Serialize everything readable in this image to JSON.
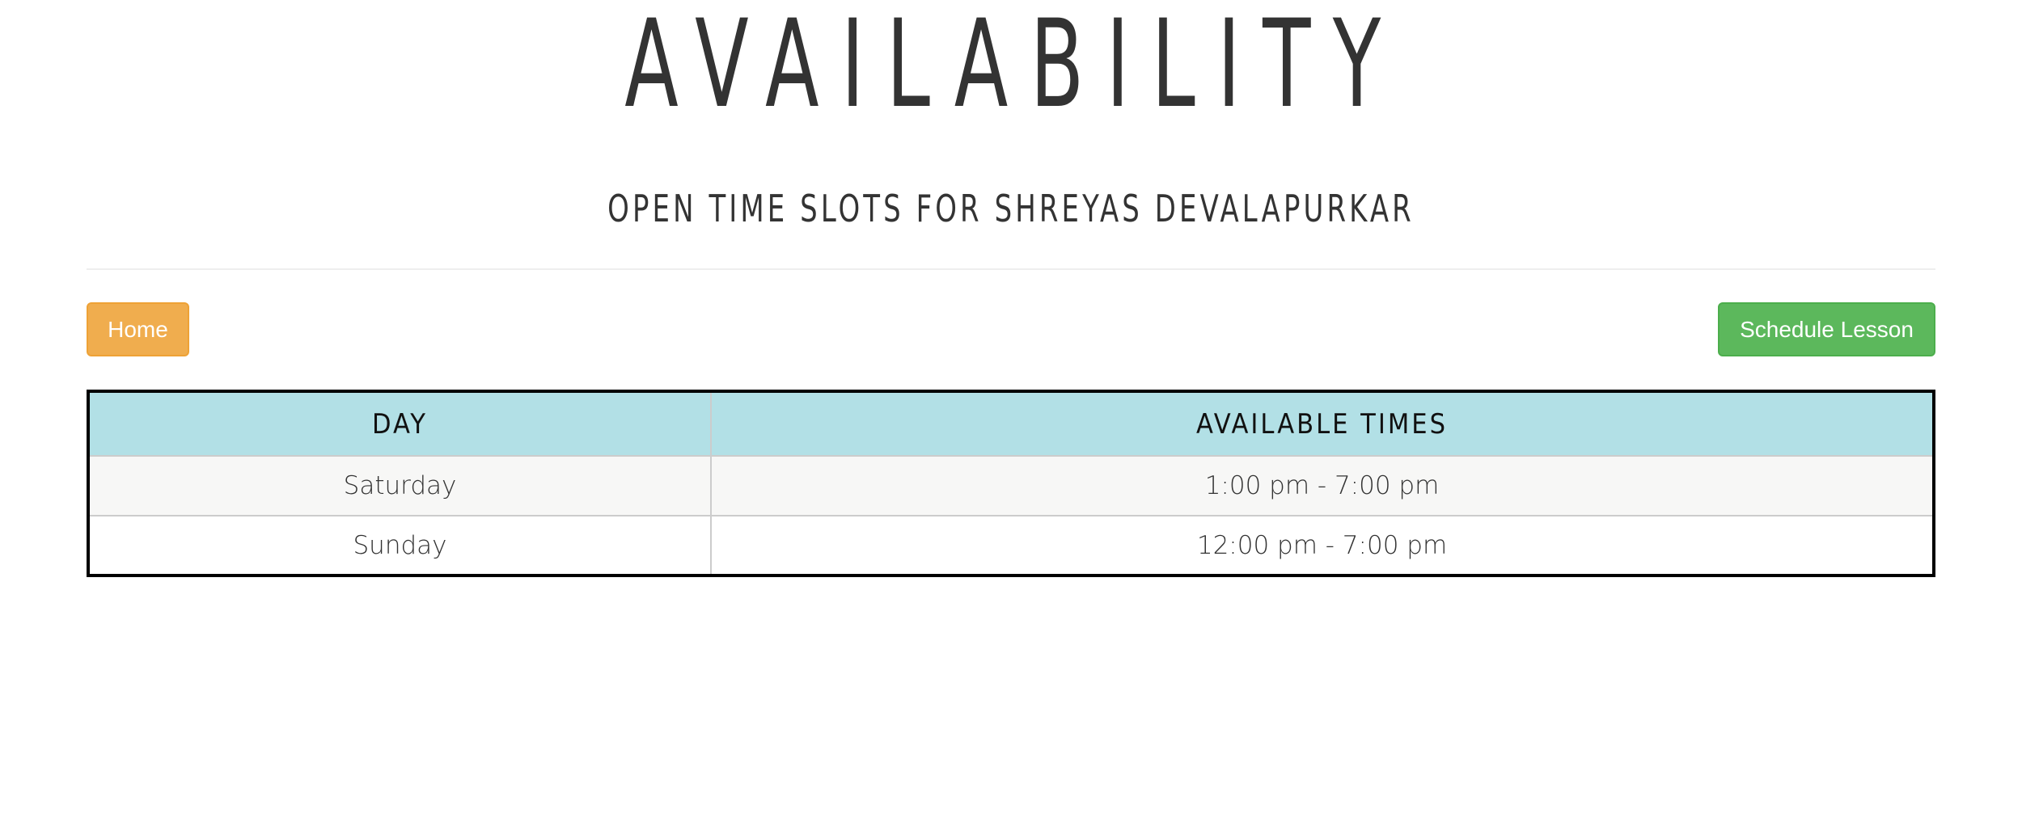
{
  "header": {
    "title": "AVAILABILITY",
    "subtitle": "OPEN TIME SLOTS FOR SHREYAS DEVALAPURKAR"
  },
  "nav": {
    "home_label": "Home",
    "schedule_label": "Schedule Lesson"
  },
  "table": {
    "columns": [
      "DAY",
      "AVAILABLE TIMES"
    ],
    "rows": [
      {
        "day": "Saturday",
        "times": "1:00 pm - 7:00 pm"
      },
      {
        "day": "Sunday",
        "times": "12:00 pm - 7:00 pm"
      }
    ]
  },
  "colors": {
    "home_button": "#f0ad4e",
    "schedule_button": "#5cb85c",
    "table_header": "#b2e0e6",
    "table_border": "#000000"
  }
}
